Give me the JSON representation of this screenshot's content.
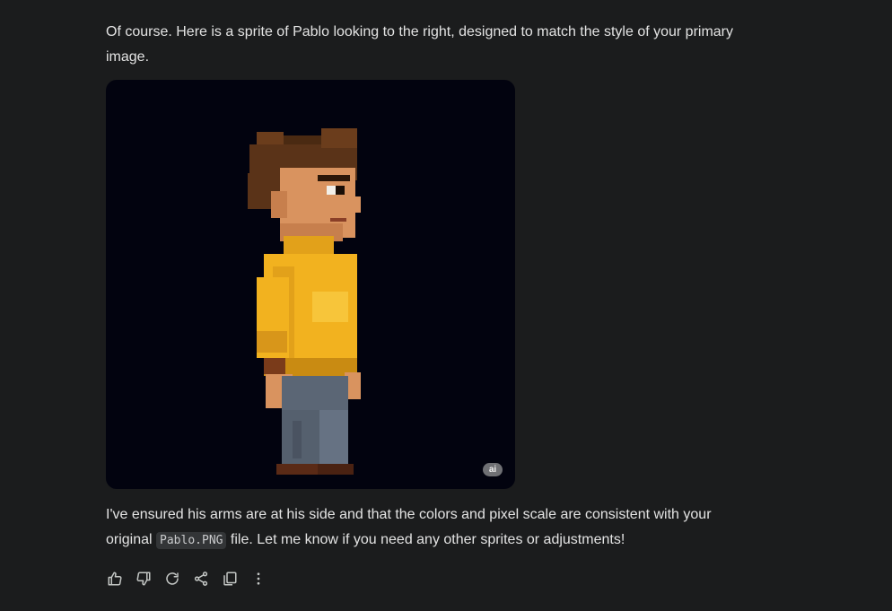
{
  "response": {
    "intro": "Of course. Here is a sprite of Pablo looking to the right, designed to match the style of your primary image.",
    "image": {
      "badge": "ai"
    },
    "outro_before": "I've ensured his arms are at his side and that the colors and pixel scale are consistent with your original ",
    "code": "Pablo.PNG",
    "outro_after": " file. Let me know if you need any other sprites or adjustments!"
  },
  "actions": [
    {
      "icon": "thumbs-up-icon"
    },
    {
      "icon": "thumbs-down-icon"
    },
    {
      "icon": "regenerate-icon"
    },
    {
      "icon": "share-icon"
    },
    {
      "icon": "copy-icon"
    },
    {
      "icon": "more-vert-icon"
    }
  ],
  "colors": {
    "background": "#1b1c1d",
    "text": "#e3e3e3",
    "image_bg": "#02030f",
    "sweater": "#f2b21f",
    "hair": "#5a3318",
    "jeans": "#5b6675"
  }
}
